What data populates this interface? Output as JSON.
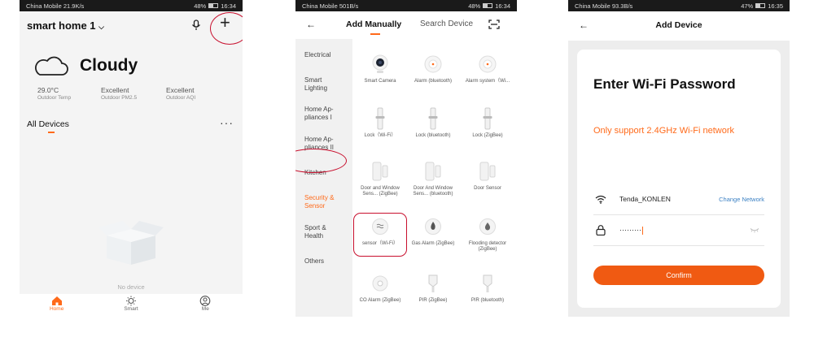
{
  "phone1": {
    "status": {
      "carrier": "China Mobile",
      "speed": "21.9K/s",
      "battery": "48%",
      "time": "16:34"
    },
    "home_name": "smart home 1",
    "weather": "Cloudy",
    "stats": [
      {
        "value": "29.0°C",
        "label": "Outdoor Temp"
      },
      {
        "value": "Excellent",
        "label": "Outdoor PM2.5"
      },
      {
        "value": "Excellent",
        "label": "Outdoor AQI"
      }
    ],
    "section_title": "All Devices",
    "more_glyph": "···",
    "add_glyph": "+",
    "empty_text": "No device",
    "tabs": [
      {
        "label": "Home",
        "icon": "home-icon"
      },
      {
        "label": "Smart",
        "icon": "sun-icon"
      },
      {
        "label": "Me",
        "icon": "person-icon"
      }
    ]
  },
  "phone2": {
    "status": {
      "carrier": "China Mobile",
      "speed": "501B/s",
      "battery": "48%",
      "time": "16:34"
    },
    "tab_manual": "Add Manually",
    "tab_search": "Search Device",
    "categories": [
      "Electrical",
      "Smart Lighting",
      "Home Ap-pliances I",
      "Home Ap-pliances II",
      "Kitchen",
      "Security & Sensor",
      "Sport & Health",
      "Others"
    ],
    "devices": [
      {
        "label": "Smart Camera",
        "icon": "camera-icon"
      },
      {
        "label": "Alarm (bluetooth)",
        "icon": "alarm-icon"
      },
      {
        "label": "Alarm system（Wi...",
        "icon": "alarm-icon"
      },
      {
        "label": "Lock（Wi-Fi）",
        "icon": "lock-icon"
      },
      {
        "label": "Lock (bluetooth)",
        "icon": "lock-icon"
      },
      {
        "label": "Lock (ZigBee)",
        "icon": "lock-icon"
      },
      {
        "label": "Door and Window Sens... (ZigBee)",
        "icon": "door-sensor-icon"
      },
      {
        "label": "Door And Window Sens... (bluetooth)",
        "icon": "door-sensor-icon"
      },
      {
        "label": "Door Sensor",
        "icon": "door-sensor-icon"
      },
      {
        "label": "sensor（Wi-Fi）",
        "icon": "sensor-icon"
      },
      {
        "label": "Gas Alarm (ZigBee)",
        "icon": "flame-icon"
      },
      {
        "label": "Flooding detector (ZigBee)",
        "icon": "drop-icon"
      },
      {
        "label": "CO Alarm (ZigBee)",
        "icon": "co-alarm-icon"
      },
      {
        "label": "PIR (ZigBee)",
        "icon": "pir-icon"
      },
      {
        "label": "PIR (bluetooth)",
        "icon": "pir-icon"
      }
    ]
  },
  "phone3": {
    "status": {
      "carrier": "China Mobile",
      "speed": "93.3B/s",
      "battery": "47%",
      "time": "16:35"
    },
    "title": "Add Device",
    "heading": "Enter Wi-Fi Password",
    "note": "Only support 2.4GHz Wi-Fi network",
    "ssid": "Tenda_KONLEN",
    "change_label": "Change Network",
    "password_mask": "·········",
    "confirm_label": "Confirm"
  },
  "colors": {
    "accent": "#ff6a1a",
    "highlight_ring": "#c8102e",
    "link": "#3d82c4"
  }
}
